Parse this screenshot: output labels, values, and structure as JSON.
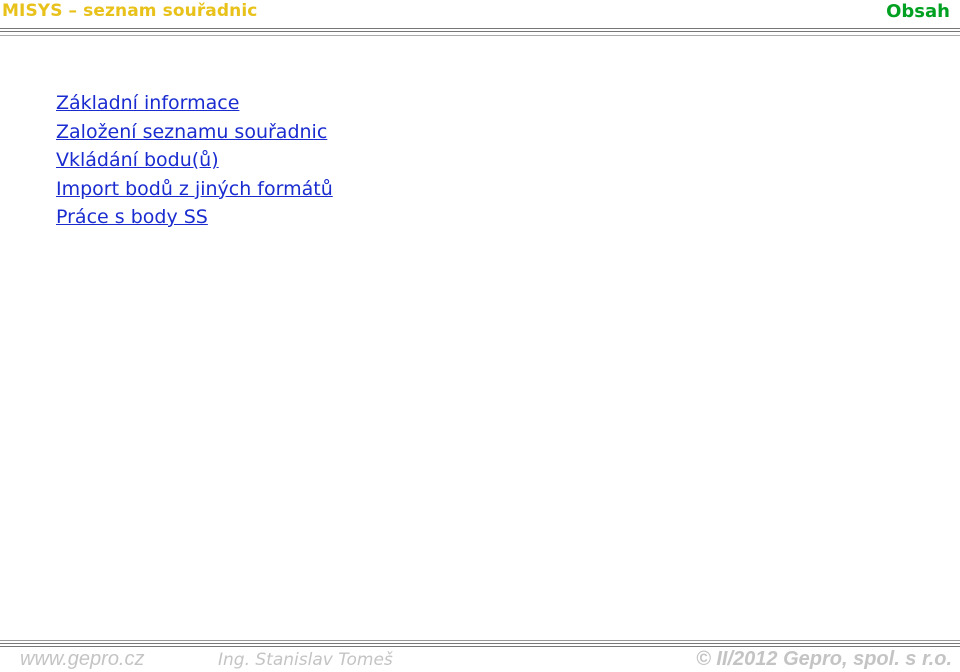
{
  "header": {
    "title": "MISYS – seznam souřadnic",
    "section": "Obsah"
  },
  "toc": {
    "links": [
      "Základní informace",
      "Založení seznamu souřadnic",
      "Vkládání bodu(ů)",
      "Import bodů z jiných formátů",
      "Práce s body SS"
    ]
  },
  "footer": {
    "website": "www.gepro.cz",
    "author": "Ing. Stanislav Tomeš",
    "copyright": "© II/2012 Gepro, spol. s r.o."
  },
  "colors": {
    "title": "#e8c21a",
    "section": "#00a020",
    "link": "#1a2cd0",
    "footer": "#c4c4c4"
  }
}
